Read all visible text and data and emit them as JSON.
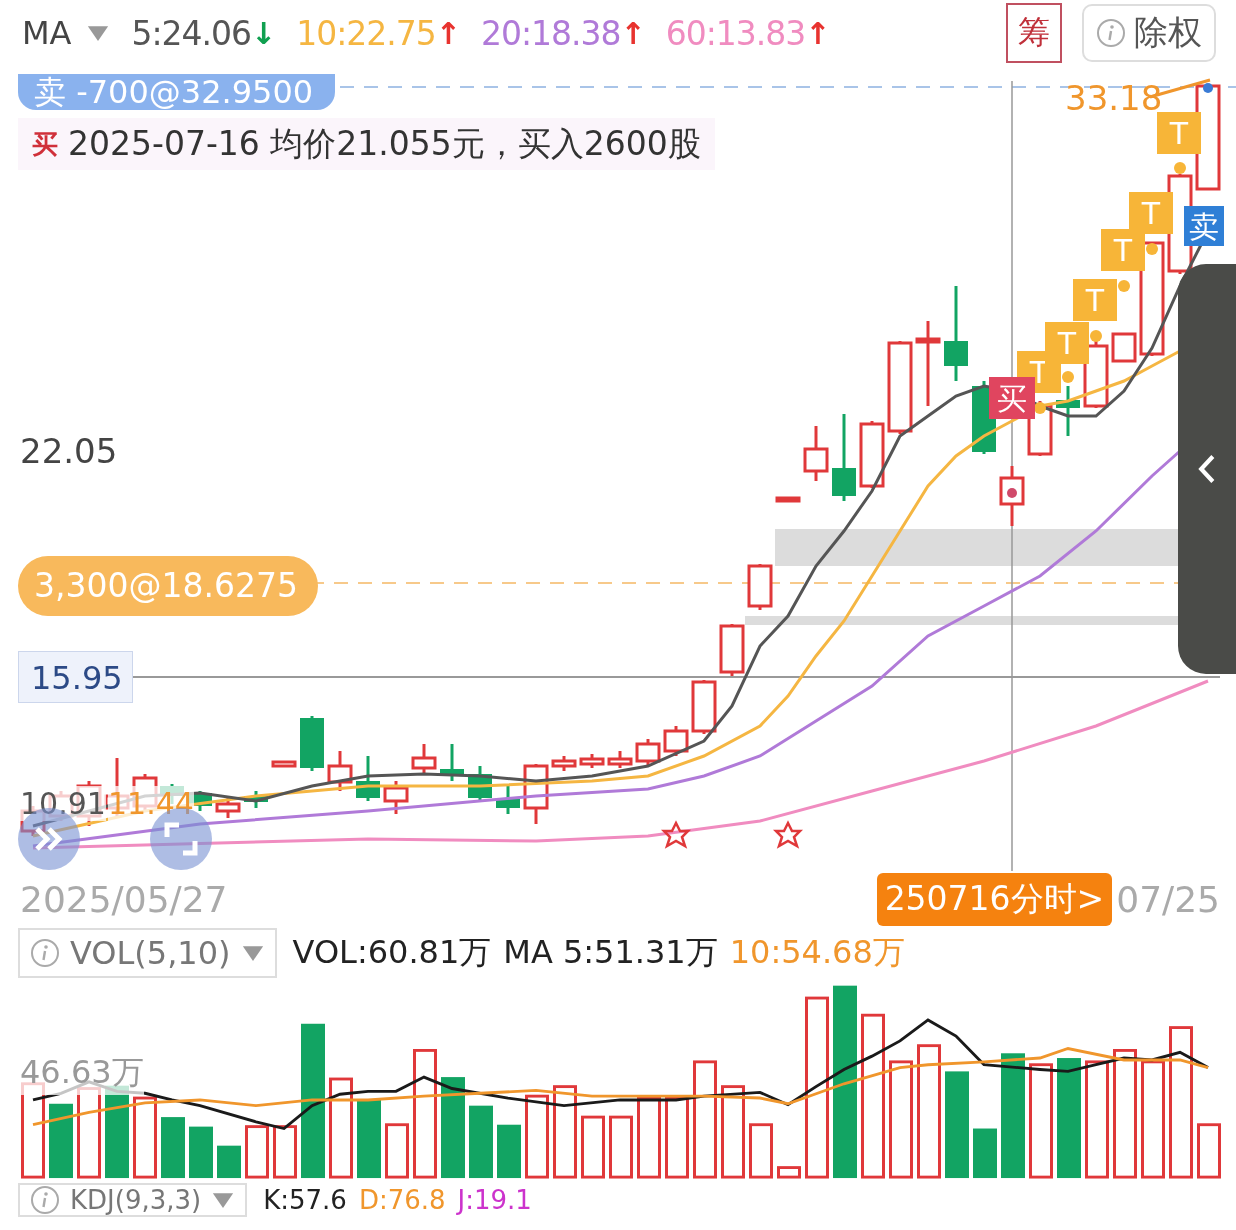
{
  "indicator_bar": {
    "name": "MA",
    "ma_values": [
      {
        "text": "5:24.06",
        "color": "#555555",
        "arrow": {
          "text": "↓",
          "color": "#10a050"
        }
      },
      {
        "text": "10:22.75",
        "color": "#f5b642",
        "arrow": {
          "text": "↑",
          "color": "#e8332f"
        }
      },
      {
        "text": "20:18.38",
        "color": "#b07ad8",
        "arrow": {
          "text": "↑",
          "color": "#e8332f"
        }
      },
      {
        "text": "60:13.83",
        "color": "#f08cc0",
        "arrow": {
          "text": "↑",
          "color": "#e8332f"
        }
      }
    ],
    "buttons": [
      {
        "label": "筹",
        "kind": "chip"
      },
      {
        "label": "除权",
        "kind": "info"
      }
    ]
  },
  "price_chart": {
    "sell_order": "卖 -700@32.9500",
    "trade_note": {
      "mark": "买",
      "text": "2025-07-16 均价21.055元，买入2600股"
    },
    "price_labels": {
      "high": "33.18",
      "mid": "22.05",
      "low": "10.91",
      "low_ma": "11.44"
    },
    "cost_label": "3,300@18.6275",
    "crosshair_price": "15.95",
    "markers": [
      {
        "text": "T",
        "kind": "t"
      },
      {
        "text": "T",
        "kind": "t"
      },
      {
        "text": "T",
        "kind": "t"
      },
      {
        "text": "T",
        "kind": "t"
      },
      {
        "text": "T",
        "kind": "t"
      },
      {
        "text": "T",
        "kind": "t"
      },
      {
        "text": "买",
        "kind": "buy"
      },
      {
        "text": "卖",
        "kind": "sell"
      }
    ]
  },
  "date_axis": {
    "start": "2025/05/27",
    "intraday_button": "250716分时>",
    "end": "07/25"
  },
  "volume_panel": {
    "selector": "VOL(5,10)",
    "scale_label": "46.63万",
    "readings": [
      {
        "text": "VOL:60.81万",
        "color": "#222222"
      },
      {
        "text": "MA 5:51.31万",
        "color": "#222222"
      },
      {
        "text": "10:54.68万",
        "color": "#f0962c"
      }
    ]
  },
  "kdj_panel": {
    "selector": "KDJ(9,3,3)",
    "readings": [
      {
        "text": "K:57.6",
        "color": "#222222"
      },
      {
        "text": "D:76.8",
        "color": "#f0962c"
      },
      {
        "text": "J:19.1",
        "color": "#cc33cc"
      }
    ]
  }
}
